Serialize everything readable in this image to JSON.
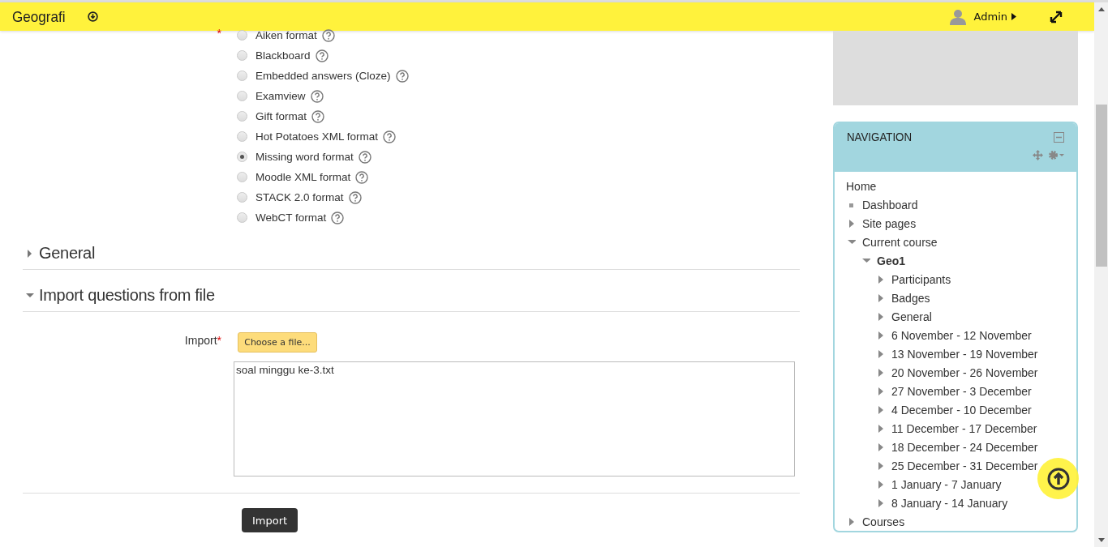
{
  "header": {
    "site_title": "Geografi",
    "user": "Admin"
  },
  "format_required_mark": "*",
  "format_options": [
    {
      "label": "Aiken format",
      "selected": false
    },
    {
      "label": "Blackboard",
      "selected": false
    },
    {
      "label": "Embedded answers (Cloze)",
      "selected": false
    },
    {
      "label": "Examview",
      "selected": false
    },
    {
      "label": "Gift format",
      "selected": false
    },
    {
      "label": "Hot Potatoes XML format",
      "selected": false
    },
    {
      "label": "Missing word format",
      "selected": true
    },
    {
      "label": "Moodle XML format",
      "selected": false
    },
    {
      "label": "STACK 2.0 format",
      "selected": false
    },
    {
      "label": "WebCT format",
      "selected": false
    }
  ],
  "sections": [
    {
      "title": "General",
      "expanded": false
    },
    {
      "title": "Import questions from file",
      "expanded": true
    }
  ],
  "import_field": {
    "label": "Import",
    "required_mark": "*",
    "button": "Choose a file...",
    "value": "soal minggu ke-3.txt"
  },
  "submit_button": "Import",
  "navigation": {
    "title": "NAVIGATION",
    "items": [
      {
        "label": "Home",
        "kind": "plain"
      },
      {
        "label": "Dashboard",
        "kind": "leaf"
      },
      {
        "label": "Site pages",
        "kind": "branch",
        "expanded": false
      },
      {
        "label": "Current course",
        "kind": "branch",
        "expanded": true,
        "children": [
          {
            "label": "Geo1",
            "kind": "branch",
            "expanded": true,
            "bold": true,
            "children": [
              {
                "label": "Participants",
                "kind": "branch",
                "expanded": false
              },
              {
                "label": "Badges",
                "kind": "branch",
                "expanded": false
              },
              {
                "label": "General",
                "kind": "branch",
                "expanded": false
              },
              {
                "label": "6 November - 12 November",
                "kind": "branch",
                "expanded": false
              },
              {
                "label": "13 November - 19 November",
                "kind": "branch",
                "expanded": false
              },
              {
                "label": "20 November - 26 November",
                "kind": "branch",
                "expanded": false
              },
              {
                "label": "27 November - 3 December",
                "kind": "branch",
                "expanded": false
              },
              {
                "label": "4 December - 10 December",
                "kind": "branch",
                "expanded": false
              },
              {
                "label": "11 December - 17 December",
                "kind": "branch",
                "expanded": false
              },
              {
                "label": "18 December - 24 December",
                "kind": "branch",
                "expanded": false
              },
              {
                "label": "25 December - 31 December",
                "kind": "branch",
                "expanded": false
              },
              {
                "label": "1 January - 7 January",
                "kind": "branch",
                "expanded": false
              },
              {
                "label": "8 January - 14 January",
                "kind": "branch",
                "expanded": false
              }
            ]
          }
        ]
      },
      {
        "label": "Courses",
        "kind": "branch",
        "expanded": false
      }
    ]
  }
}
